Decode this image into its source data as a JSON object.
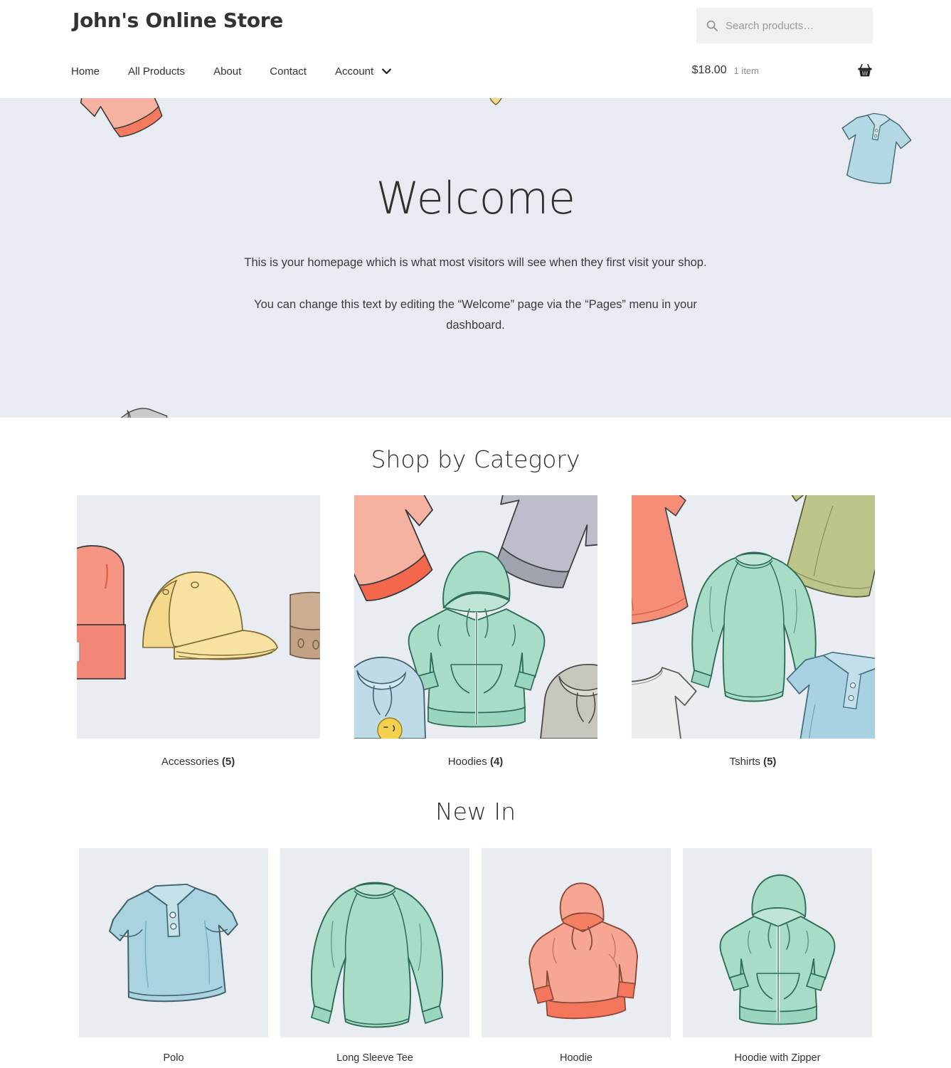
{
  "header": {
    "brand": "John's Online Store",
    "search": {
      "placeholder": "Search products…",
      "value": "",
      "icon": "search-icon"
    },
    "nav": [
      {
        "label": "Home"
      },
      {
        "label": "All Products"
      },
      {
        "label": "About"
      },
      {
        "label": "Contact"
      },
      {
        "label": "Account",
        "icon": "chevron-down-icon",
        "has_dropdown": true
      }
    ],
    "cart": {
      "total": "$18.00",
      "count": "1 item",
      "icon": "shopping-basket-icon"
    }
  },
  "hero": {
    "title": "Welcome",
    "paragraph1": "This is your homepage which is what most visitors will see when they first visit your shop.",
    "paragraph2": "You can change this text by editing the “Welcome” page via the “Pages” menu in your dashboard.",
    "background_color": "#e8ecf2",
    "decorations": [
      {
        "name": "coral-hoodie-top-left",
        "color": "#f4a08c"
      },
      {
        "name": "yellow-cap-top-center",
        "color": "#f2d98a"
      },
      {
        "name": "blue-polo-top-right",
        "color": "#a9d4e0"
      },
      {
        "name": "gray-hoodie-left",
        "color": "#b9bcbd"
      },
      {
        "name": "white-tshirt-right",
        "color": "#e6e8e9"
      },
      {
        "name": "mint-sweater-bottom-center",
        "color": "#9ed7c2"
      }
    ]
  },
  "categories_section": {
    "title": "Shop by Category",
    "items": [
      {
        "name": "Accessories",
        "count": "5",
        "image": "accessories-category-image"
      },
      {
        "name": "Hoodies",
        "count": "4",
        "image": "hoodies-category-image"
      },
      {
        "name": "Tshirts",
        "count": "5",
        "image": "tshirts-category-image"
      }
    ]
  },
  "new_in_section": {
    "title": "New In",
    "products": [
      {
        "name": "Polo",
        "image": "polo-product-image"
      },
      {
        "name": "Long Sleeve Tee",
        "image": "long-sleeve-tee-product-image"
      },
      {
        "name": "Hoodie",
        "image": "hoodie-product-image"
      },
      {
        "name": "Hoodie with Zipper",
        "image": "hoodie-with-zipper-product-image"
      }
    ]
  },
  "colors": {
    "hero_bg": "#e8ecf2",
    "thumb_bg": "#e9edf2",
    "search_bg": "#f0f0f0",
    "text": "#333333",
    "muted_text": "#8d8d8d",
    "mint": "#a7ddc7",
    "coral": "#f5a390",
    "sky": "#aad6e2",
    "gray": "#c7cacb",
    "olive": "#bfc78e",
    "tan": "#cdb096",
    "yellow": "#f5e1a0"
  }
}
